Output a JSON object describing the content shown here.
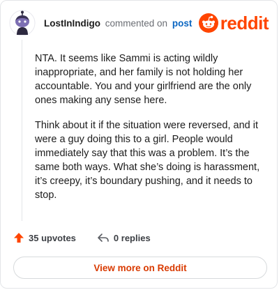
{
  "header": {
    "username": "LostInIndigo",
    "action_text": "commented on",
    "post_link": "post",
    "brand": "reddit"
  },
  "comment": {
    "paragraphs": [
      "NTA. It seems like Sammi is acting wildly inappropriate, and her family is not holding her accountable. You and your girlfriend are the only ones making any sense here.",
      "Think about it if the situation were reversed, and it were a guy doing this to a girl. People would immediately say that this was a problem. It’s the same both ways. What she’s doing is harassment, it’s creepy, it’s boundary pushing, and it needs to stop."
    ]
  },
  "actions": {
    "upvotes": "35 upvotes",
    "replies": "0 replies"
  },
  "footer": {
    "view_more": "View more on Reddit"
  },
  "colors": {
    "brand": "#ff4500",
    "link": "#0a66c2",
    "view_more": "#d93a00",
    "upvote": "#ff4500"
  },
  "icons": {
    "avatar": "user-avatar",
    "brand": "reddit-snoo-icon",
    "upvote": "upvote-arrow-icon",
    "reply": "reply-arrow-icon"
  }
}
